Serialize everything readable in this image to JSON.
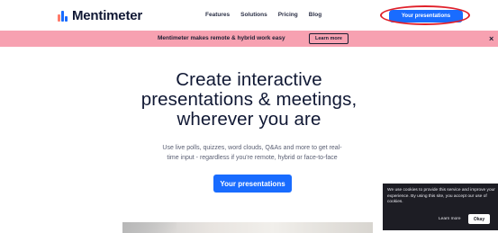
{
  "header": {
    "logo_text": "Mentimeter",
    "nav": [
      "Features",
      "Solutions",
      "Pricing",
      "Blog"
    ],
    "cta_label": "Your presentations",
    "cta_highlight_color": "#e0202a"
  },
  "banner": {
    "text": "Mentimeter makes remote & hybrid work easy",
    "button_label": "Learn more",
    "close_glyph": "×",
    "background": "#f7a1b1"
  },
  "hero": {
    "title_lines": [
      "Create interactive",
      "presentations & meetings,",
      "wherever you are"
    ],
    "subtitle_lines": [
      "Use live polls, quizzes, word clouds, Q&As and more to get real-",
      "time input - regardless if you're remote, hybrid or face-to-face"
    ],
    "button_label": "Your presentations"
  },
  "cookie": {
    "text": "We use cookies to provide this service and improve your experience. By using this site, you accept our use of cookies.",
    "learn_more": "Learn more",
    "okay": "Okay"
  },
  "colors": {
    "brand_blue": "#196cff",
    "dark": "#101834"
  }
}
